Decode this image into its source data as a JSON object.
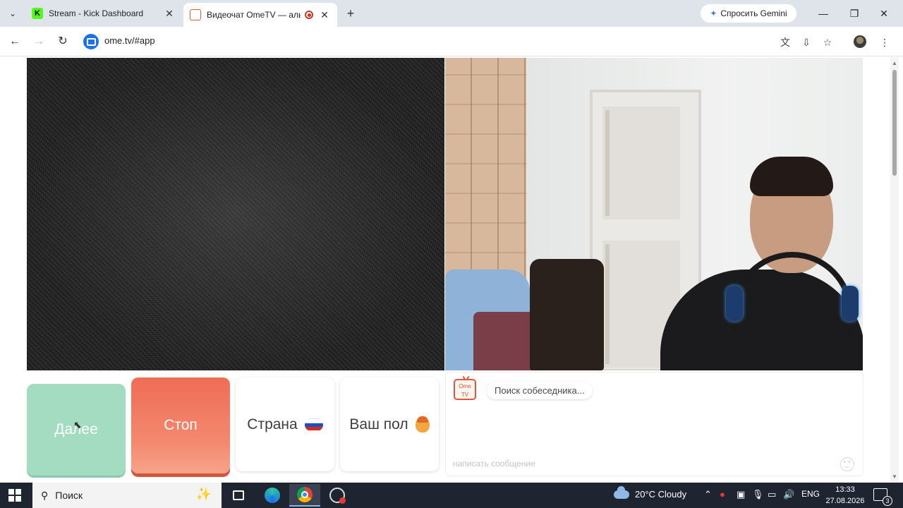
{
  "browser": {
    "tabs": [
      {
        "title": "Stream - Kick Dashboard",
        "active": false
      },
      {
        "title": "Видеочат OmeTV — альте",
        "active": true,
        "recording": true
      }
    ],
    "new_tab_label": "+",
    "gemini_label": "Спросить Gemini",
    "url": "ome.tv/#app",
    "window_buttons": {
      "minimize": "—",
      "restore": "❐",
      "close": "✕"
    }
  },
  "controls": {
    "next_label": "Далее",
    "stop_label": "Стоп",
    "country_label": "Страна",
    "gender_label": "Ваш пол"
  },
  "chat": {
    "logo_text": "Ome TV",
    "status_message": "Поиск собеседника...",
    "input_placeholder": "написать сообщение"
  },
  "taskbar": {
    "search_placeholder": "Поиск",
    "weather": "20°C Cloudy",
    "language": "ENG",
    "time": "13:33",
    "date": "27.08.2026",
    "notification_count": "3"
  },
  "colors": {
    "next_button": "#a3dcc1",
    "stop_button": "#ef6c55",
    "accent": "#e4553c"
  }
}
